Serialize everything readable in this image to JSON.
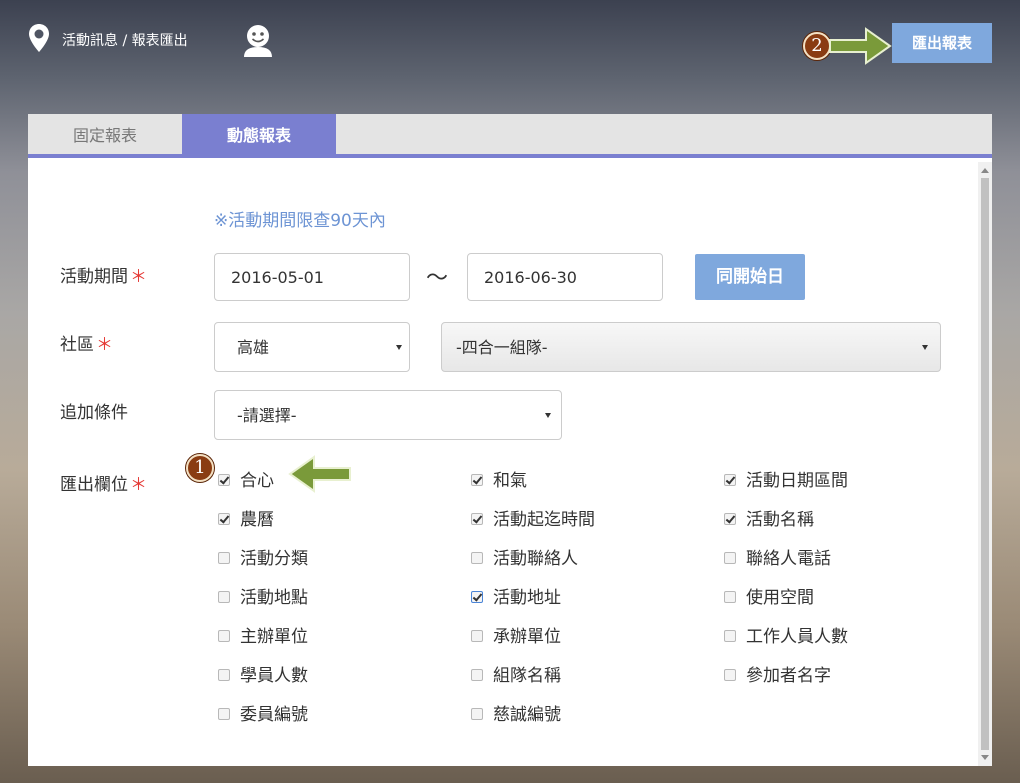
{
  "header": {
    "breadcrumb": "活動訊息 / 報表匯出",
    "export_button": "匯出報表",
    "badge_1": "1",
    "badge_2": "2",
    "accent_color": "#7fa8dd",
    "arrow_color": "#7a9a3a",
    "badge_color": "#8a3c12"
  },
  "tabs": [
    {
      "label": "固定報表",
      "active": false
    },
    {
      "label": "動態報表",
      "active": true
    }
  ],
  "form": {
    "note": "※活動期間限查90天內",
    "period_label": "活動期間",
    "required_mark": "＊",
    "start_date": "2016-05-01",
    "tilde": "〜",
    "end_date": "2016-06-30",
    "same_start_button": "同開始日",
    "community_label": "社區",
    "community_value": "高雄",
    "team_value": "-四合一組隊-",
    "extra_label": "追加條件",
    "extra_value": "-請選擇-",
    "fields_label": "匯出欄位"
  },
  "fields": [
    {
      "label": "合心",
      "checked": true
    },
    {
      "label": "和氣",
      "checked": true
    },
    {
      "label": "活動日期區間",
      "checked": true
    },
    {
      "label": "農曆",
      "checked": true
    },
    {
      "label": "活動起迄時間",
      "checked": true
    },
    {
      "label": "活動名稱",
      "checked": true
    },
    {
      "label": "活動分類",
      "checked": false
    },
    {
      "label": "活動聯絡人",
      "checked": false
    },
    {
      "label": "聯絡人電話",
      "checked": false
    },
    {
      "label": "活動地點",
      "checked": false
    },
    {
      "label": "活動地址",
      "checked": true
    },
    {
      "label": "使用空間",
      "checked": false
    },
    {
      "label": "主辦單位",
      "checked": false
    },
    {
      "label": "承辦單位",
      "checked": false
    },
    {
      "label": "工作人員人數",
      "checked": false
    },
    {
      "label": "學員人數",
      "checked": false
    },
    {
      "label": "組隊名稱",
      "checked": false
    },
    {
      "label": "參加者名字",
      "checked": false
    },
    {
      "label": "委員編號",
      "checked": false
    },
    {
      "label": "慈誠編號",
      "checked": false
    }
  ]
}
